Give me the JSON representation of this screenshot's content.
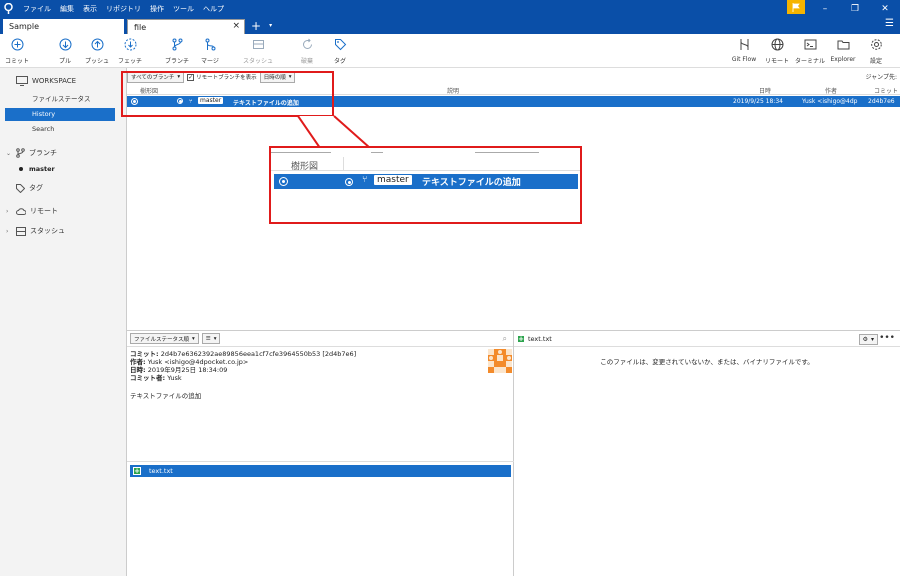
{
  "menu": [
    "ファイル",
    "編集",
    "表示",
    "リポジトリ",
    "操作",
    "ツール",
    "ヘルプ"
  ],
  "tabs": {
    "sample": "Sample",
    "file": "file",
    "close": "×",
    "add": "+",
    "drop": "▾"
  },
  "window": {
    "minimize": "–",
    "maximize": "❐",
    "close": "✕"
  },
  "toolbar": {
    "commit": "コミット",
    "pull": "プル",
    "push": "プッシュ",
    "fetch": "フェッチ",
    "branch": "ブランチ",
    "merge": "マージ",
    "stash": "スタッシュ",
    "discard": "破棄",
    "tag": "タグ",
    "gitflow": "Git Flow",
    "remote": "リモート",
    "terminal": "ターミナル",
    "explorer": "Explorer",
    "settings": "設定"
  },
  "sidebar": {
    "workspace": "WORKSPACE",
    "file_status": "ファイルステータス",
    "history": "History",
    "search": "Search",
    "branches": "ブランチ",
    "master": "master",
    "tags": "タグ",
    "remotes": "リモート",
    "stashes": "スタッシュ"
  },
  "history": {
    "branch_filter": "すべてのブランチ",
    "show_remote": "リモートブランチを表示",
    "sort": "日時の順",
    "jump": "ジャンプ先:",
    "columns": {
      "graph": "樹形図",
      "desc": "説明",
      "date": "日時",
      "author": "作者",
      "commit": "コミット"
    },
    "row": {
      "branch": "master",
      "message": "テキストファイルの追加",
      "date": "2019/9/25 18:34",
      "author": "Yusk <ishigo@4dp",
      "hash": "2d4b7e6"
    }
  },
  "info": {
    "sort_label": "ファイルステータス順",
    "commit_label": "コミット:",
    "commit_value": "2d4b7e6362392ae89856eea1cf7cfe3964550b53 [2d4b7e6]",
    "author_label": "作者:",
    "author_value": "Yusk <ishigo@4dpocket.co.jp>",
    "date_label": "日時:",
    "date_value": "2019年9月25日 18:34:09",
    "committer_label": "コミット者:",
    "committer_value": "Yusk",
    "message": "テキストファイルの追加",
    "file": "text.txt"
  },
  "diff": {
    "file": "text.txt",
    "message": "このファイルは、変更されていないか、または、バイナリファイルです。"
  },
  "colors": {
    "accent": "#1a6fc9",
    "titlebar": "#0a4fa8",
    "highlight": "#e01b1b",
    "added": "#2da44e"
  }
}
